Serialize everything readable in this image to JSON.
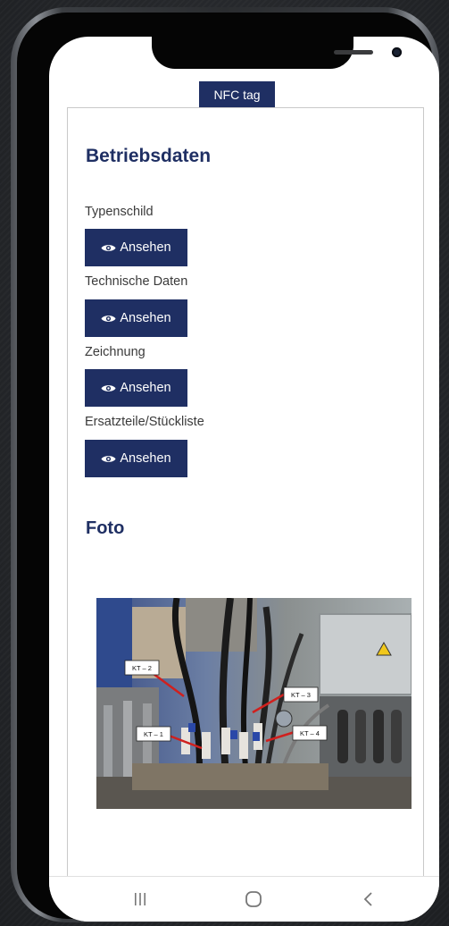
{
  "header": {
    "tab_label": "NFC tag"
  },
  "operating_data": {
    "title": "Betriebsdaten",
    "items": [
      {
        "label": "Typenschild",
        "button_label": "Ansehen"
      },
      {
        "label": "Technische Daten",
        "button_label": "Ansehen"
      },
      {
        "label": "Zeichnung",
        "button_label": "Ansehen"
      },
      {
        "label": "Ersatzteile/Stückliste",
        "button_label": "Ansehen"
      }
    ]
  },
  "photo_section": {
    "title": "Foto",
    "callouts": [
      "KT – 2",
      "KT – 3",
      "KT – 1",
      "KT – 4"
    ]
  },
  "icons": {
    "view": "eye-icon",
    "warning": "warning-triangle-icon",
    "nav": [
      "recent-apps-icon",
      "home-icon",
      "back-icon"
    ]
  },
  "colors": {
    "accent": "#1f2f63",
    "background": "#ffffff",
    "photo_callout_line": "#d0201e"
  }
}
